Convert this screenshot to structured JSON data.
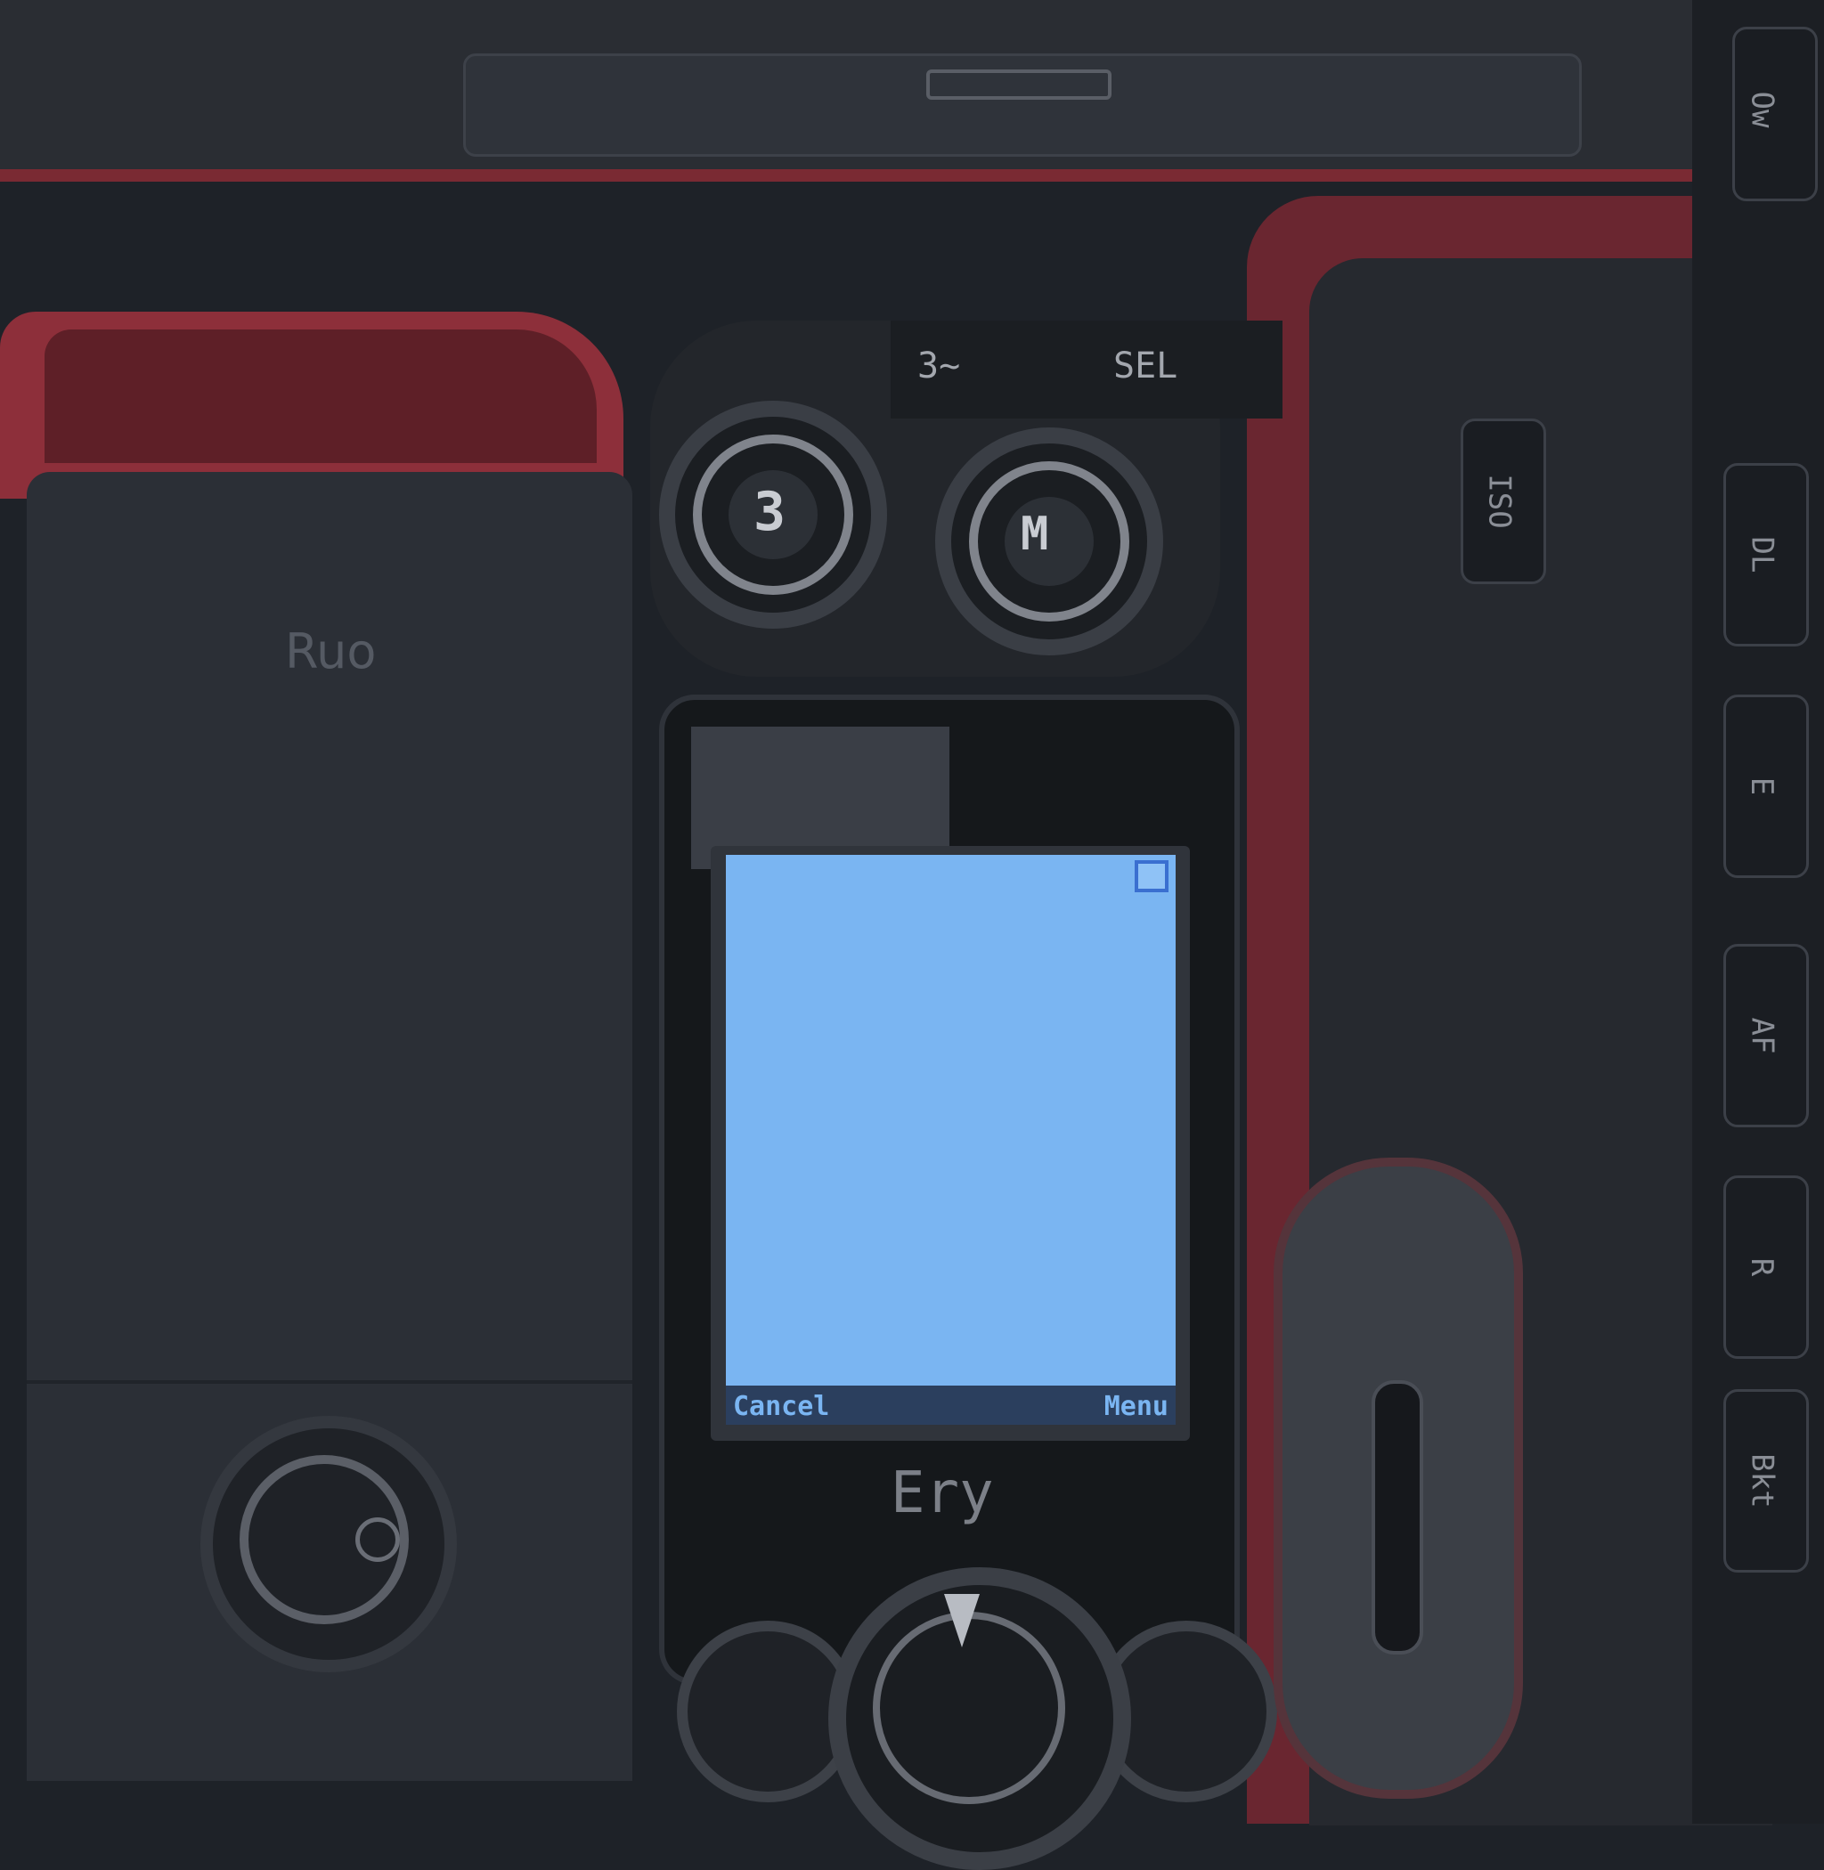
{
  "device": {
    "left_panel_label": "Ruo",
    "model_label": "",
    "brand_label": "Ery",
    "dial_left_label": "3",
    "dial_right_label": "M",
    "top_label_1": "3~",
    "top_label_2": "SEL",
    "side_buttons": [
      "Ow",
      "DL",
      "E",
      "AF",
      "R",
      "Bkt",
      "ISO"
    ]
  },
  "lcd": {
    "status_icons": "",
    "title": "",
    "softkey_left": "Cancel",
    "softkey_right": "Menu"
  },
  "colors": {
    "lcd_background": "#7ab5f2",
    "lcd_text": "#3a6fd0",
    "body_red": "#8d2f3a",
    "body_dark": "#1e2228"
  }
}
